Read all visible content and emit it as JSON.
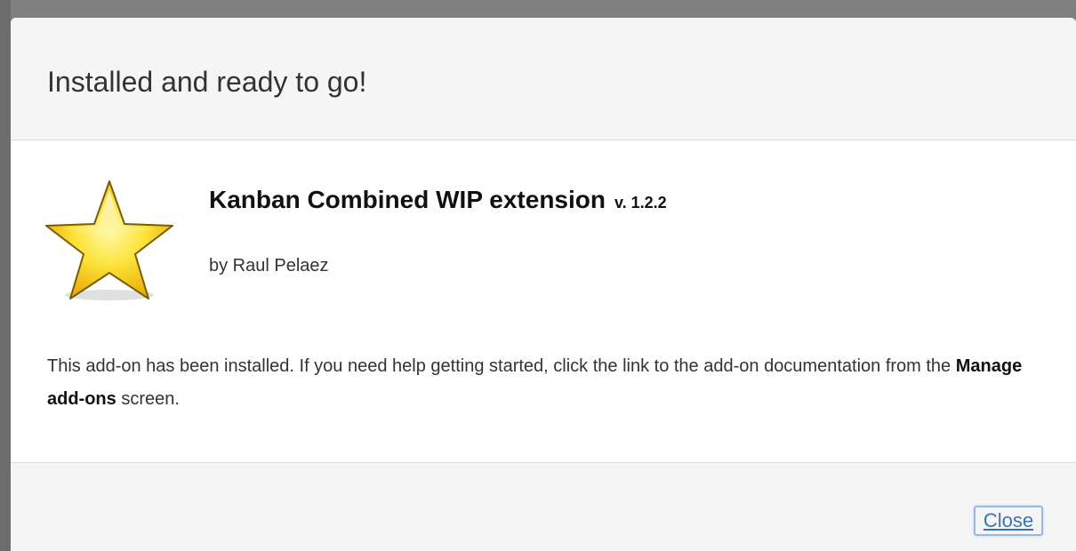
{
  "dialog": {
    "title": "Installed and ready to go!"
  },
  "addon": {
    "icon": "star-icon",
    "name": "Kanban Combined WIP extension",
    "version": "v. 1.2.2",
    "author": "by Raul Pelaez",
    "description_before": "This add-on has been installed. If you need help getting started, click the link to the add-on documentation from the ",
    "description_bold": "Manage add-ons",
    "description_after": " screen."
  },
  "footer": {
    "close_label": "Close"
  },
  "colors": {
    "star_fill": "#f7cf10",
    "star_highlight": "#fff9a8",
    "star_outline": "#8a6a00",
    "link": "#3b73b9",
    "focus_ring": "#9ab7ea"
  }
}
